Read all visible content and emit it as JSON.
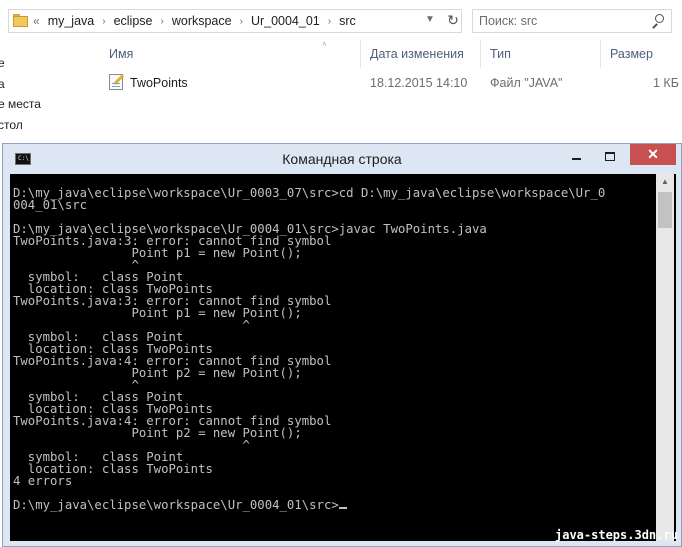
{
  "explorer": {
    "breadcrumb": {
      "lead": "«",
      "items": [
        "my_java",
        "eclipse",
        "workspace",
        "Ur_0004_01",
        "src"
      ],
      "separator": "›"
    },
    "search": {
      "placeholder": "Поиск: src"
    },
    "nav_items": [
      "е",
      "а",
      "е места",
      "стол"
    ],
    "columns": {
      "name": "Имя",
      "date": "Дата изменения",
      "type": "Тип",
      "size": "Размер"
    },
    "files": [
      {
        "name": "TwoPoints",
        "date": "18.12.2015 14:10",
        "type": "Файл \"JAVA\"",
        "size": "1 КБ",
        "icon": "java-file-icon"
      }
    ]
  },
  "console": {
    "title": "Командная строка",
    "text_color": "#c0c0c0",
    "background": "#000000",
    "lines": [
      "D:\\my_java\\eclipse\\workspace\\Ur_0003_07\\src>cd D:\\my_java\\eclipse\\workspace\\Ur_0",
      "004_01\\src",
      "",
      "D:\\my_java\\eclipse\\workspace\\Ur_0004_01\\src>javac TwoPoints.java",
      "TwoPoints.java:3: error: cannot find symbol",
      "                Point p1 = new Point();",
      "                ^",
      "  symbol:   class Point",
      "  location: class TwoPoints",
      "TwoPoints.java:3: error: cannot find symbol",
      "                Point p1 = new Point();",
      "                               ^",
      "  symbol:   class Point",
      "  location: class TwoPoints",
      "TwoPoints.java:4: error: cannot find symbol",
      "                Point p2 = new Point();",
      "                ^",
      "  symbol:   class Point",
      "  location: class TwoPoints",
      "TwoPoints.java:4: error: cannot find symbol",
      "                Point p2 = new Point();",
      "                               ^",
      "  symbol:   class Point",
      "  location: class TwoPoints",
      "4 errors",
      "",
      "D:\\my_java\\eclipse\\workspace\\Ur_0004_01\\src>"
    ]
  },
  "watermark": "java-steps.3dn.ru",
  "colors": {
    "close_button": "#c75050",
    "title_bar": "#dde7f3",
    "column_header": "#4c607a"
  }
}
